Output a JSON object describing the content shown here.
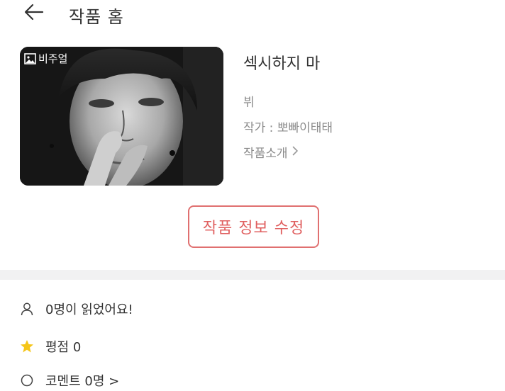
{
  "header": {
    "title": "작품 홈"
  },
  "work": {
    "badge_label": "비주얼",
    "title": "섹시하지 마",
    "genre": "뷔",
    "author": "작가 : 뽀빠이태태",
    "intro_label": "작품소개"
  },
  "actions": {
    "edit_label": "작품 정보 수정"
  },
  "stats": {
    "readers": "0명이 읽었어요!",
    "rating": "평점 0",
    "comments": "코멘트 0명 >"
  },
  "colors": {
    "accent": "#e06060",
    "star": "#f5c518",
    "muted": "#8a8a8a",
    "band": "#f1f1f2"
  }
}
